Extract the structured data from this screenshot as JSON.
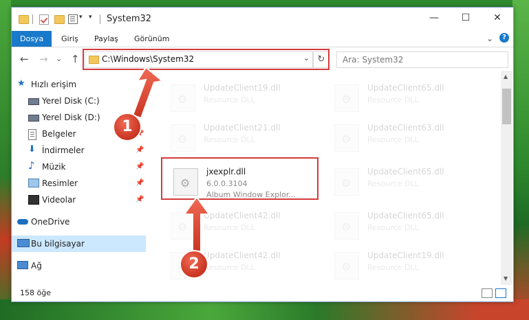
{
  "window": {
    "title": "System32",
    "controls": {
      "minimize": "—",
      "maximize": "☐",
      "close": "✕"
    }
  },
  "ribbon": {
    "tabs": [
      "Dosya",
      "Giriş",
      "Paylaş",
      "Görünüm"
    ],
    "expand_glyph": "⌄",
    "help": "?"
  },
  "nav": {
    "back": "←",
    "forward": "→",
    "recent": "⌄",
    "up": "↑",
    "address": "C:\\Windows\\System32",
    "dropdown": "⌄",
    "refresh": "↻",
    "search_placeholder": "Ara: System32"
  },
  "sidebar": {
    "items": [
      {
        "label": "Hızlı erişim",
        "icon": "star-icon"
      },
      {
        "label": "Yerel Disk (C:)",
        "icon": "drive-icon"
      },
      {
        "label": "Yerel Disk (D:)",
        "icon": "drive-icon"
      },
      {
        "label": "Belgeler",
        "icon": "document-icon"
      },
      {
        "label": "İndirmeler",
        "icon": "download-icon"
      },
      {
        "label": "Müzik",
        "icon": "music-icon"
      },
      {
        "label": "Resimler",
        "icon": "pictures-icon"
      },
      {
        "label": "Videolar",
        "icon": "video-icon"
      },
      {
        "label": "OneDrive",
        "icon": "cloud-icon"
      },
      {
        "label": "Bu bilgisayar",
        "icon": "computer-icon"
      },
      {
        "label": "Ağ",
        "icon": "network-icon"
      }
    ],
    "pin_glyph": "📌"
  },
  "files": {
    "left": [
      {
        "name": "UpdateClient19.dll",
        "desc": "Resource DLL"
      },
      {
        "name": "UpdateClient21.dll",
        "desc": "Resource DLL"
      },
      {
        "name": "jxexplr.dll",
        "version": "6.0.0.3104",
        "desc": "Album Window Explor..."
      },
      {
        "name": "UpdateClient42.dll",
        "desc": "Resource DLL"
      },
      {
        "name": "UpdateClient42.dll",
        "desc": "Resource DLL"
      }
    ],
    "right": [
      {
        "name": "UpdateClient65.dll",
        "desc": "Resource DLL"
      },
      {
        "name": "UpdateClient63.dll",
        "desc": "Resource DLL"
      },
      {
        "name": "UpdateClient65.dll",
        "desc": "Resource DLL"
      },
      {
        "name": "UpdateClient65.dll",
        "desc": "Resource DLL"
      },
      {
        "name": "UpdateClient19.dll",
        "desc": "Resource DLL"
      }
    ]
  },
  "scrollbar": {
    "up": "▲",
    "down": "▼"
  },
  "status": {
    "count": "158 öğe"
  },
  "annotations": {
    "step1": "1",
    "step2": "2",
    "accent": "#d43b3b"
  }
}
